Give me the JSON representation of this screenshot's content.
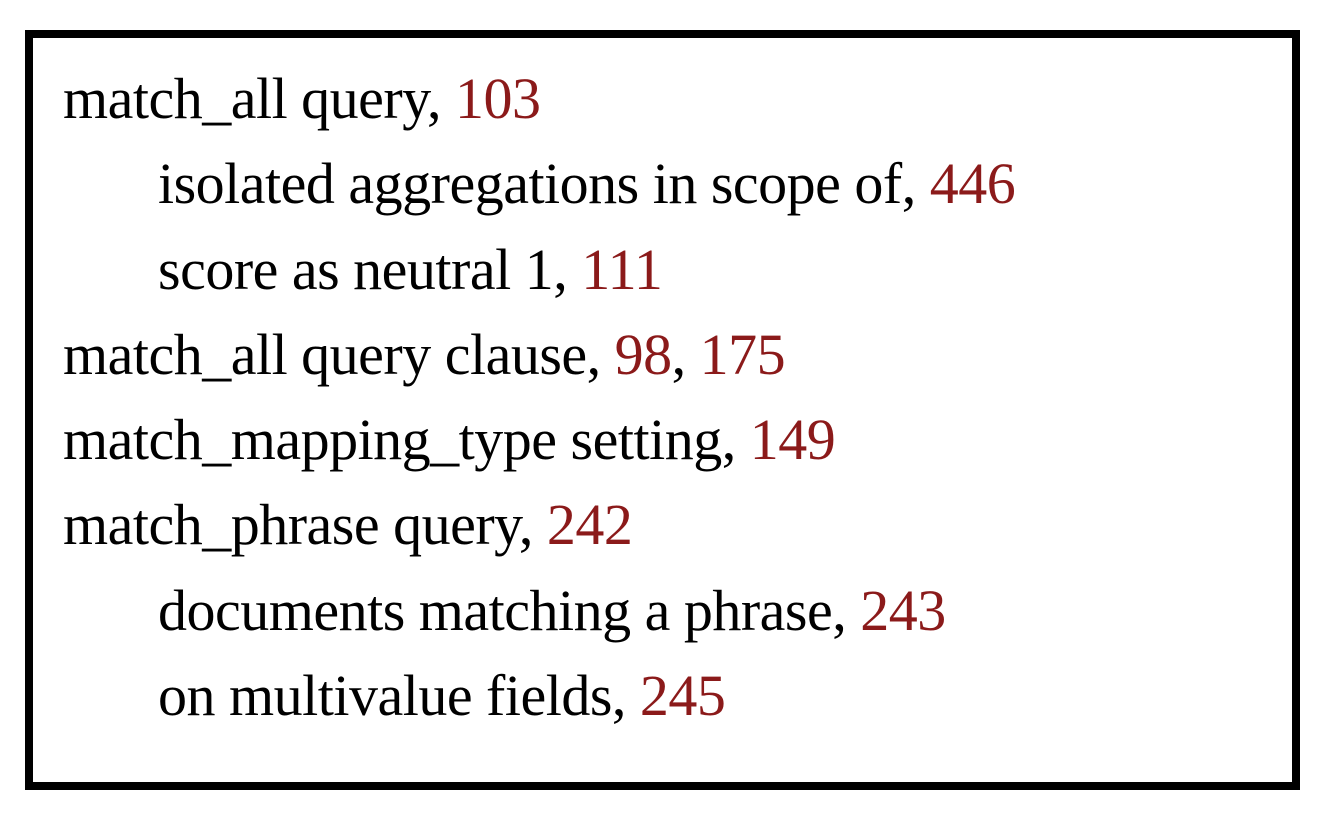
{
  "entries": [
    {
      "type": "main",
      "text": "match_all query",
      "pages": [
        "103"
      ]
    },
    {
      "type": "sub",
      "text": "isolated aggregations in scope of",
      "pages": [
        "446"
      ]
    },
    {
      "type": "sub",
      "text": "score as neutral 1",
      "pages": [
        "111"
      ]
    },
    {
      "type": "main",
      "text": "match_all query clause",
      "pages": [
        "98",
        "175"
      ]
    },
    {
      "type": "main",
      "text": "match_mapping_type setting",
      "pages": [
        "149"
      ]
    },
    {
      "type": "main",
      "text": "match_phrase query",
      "pages": [
        "242"
      ]
    },
    {
      "type": "sub",
      "text": "documents matching a phrase",
      "pages": [
        "243"
      ]
    },
    {
      "type": "sub",
      "text": "on multivalue fields",
      "pages": [
        "245"
      ]
    }
  ]
}
